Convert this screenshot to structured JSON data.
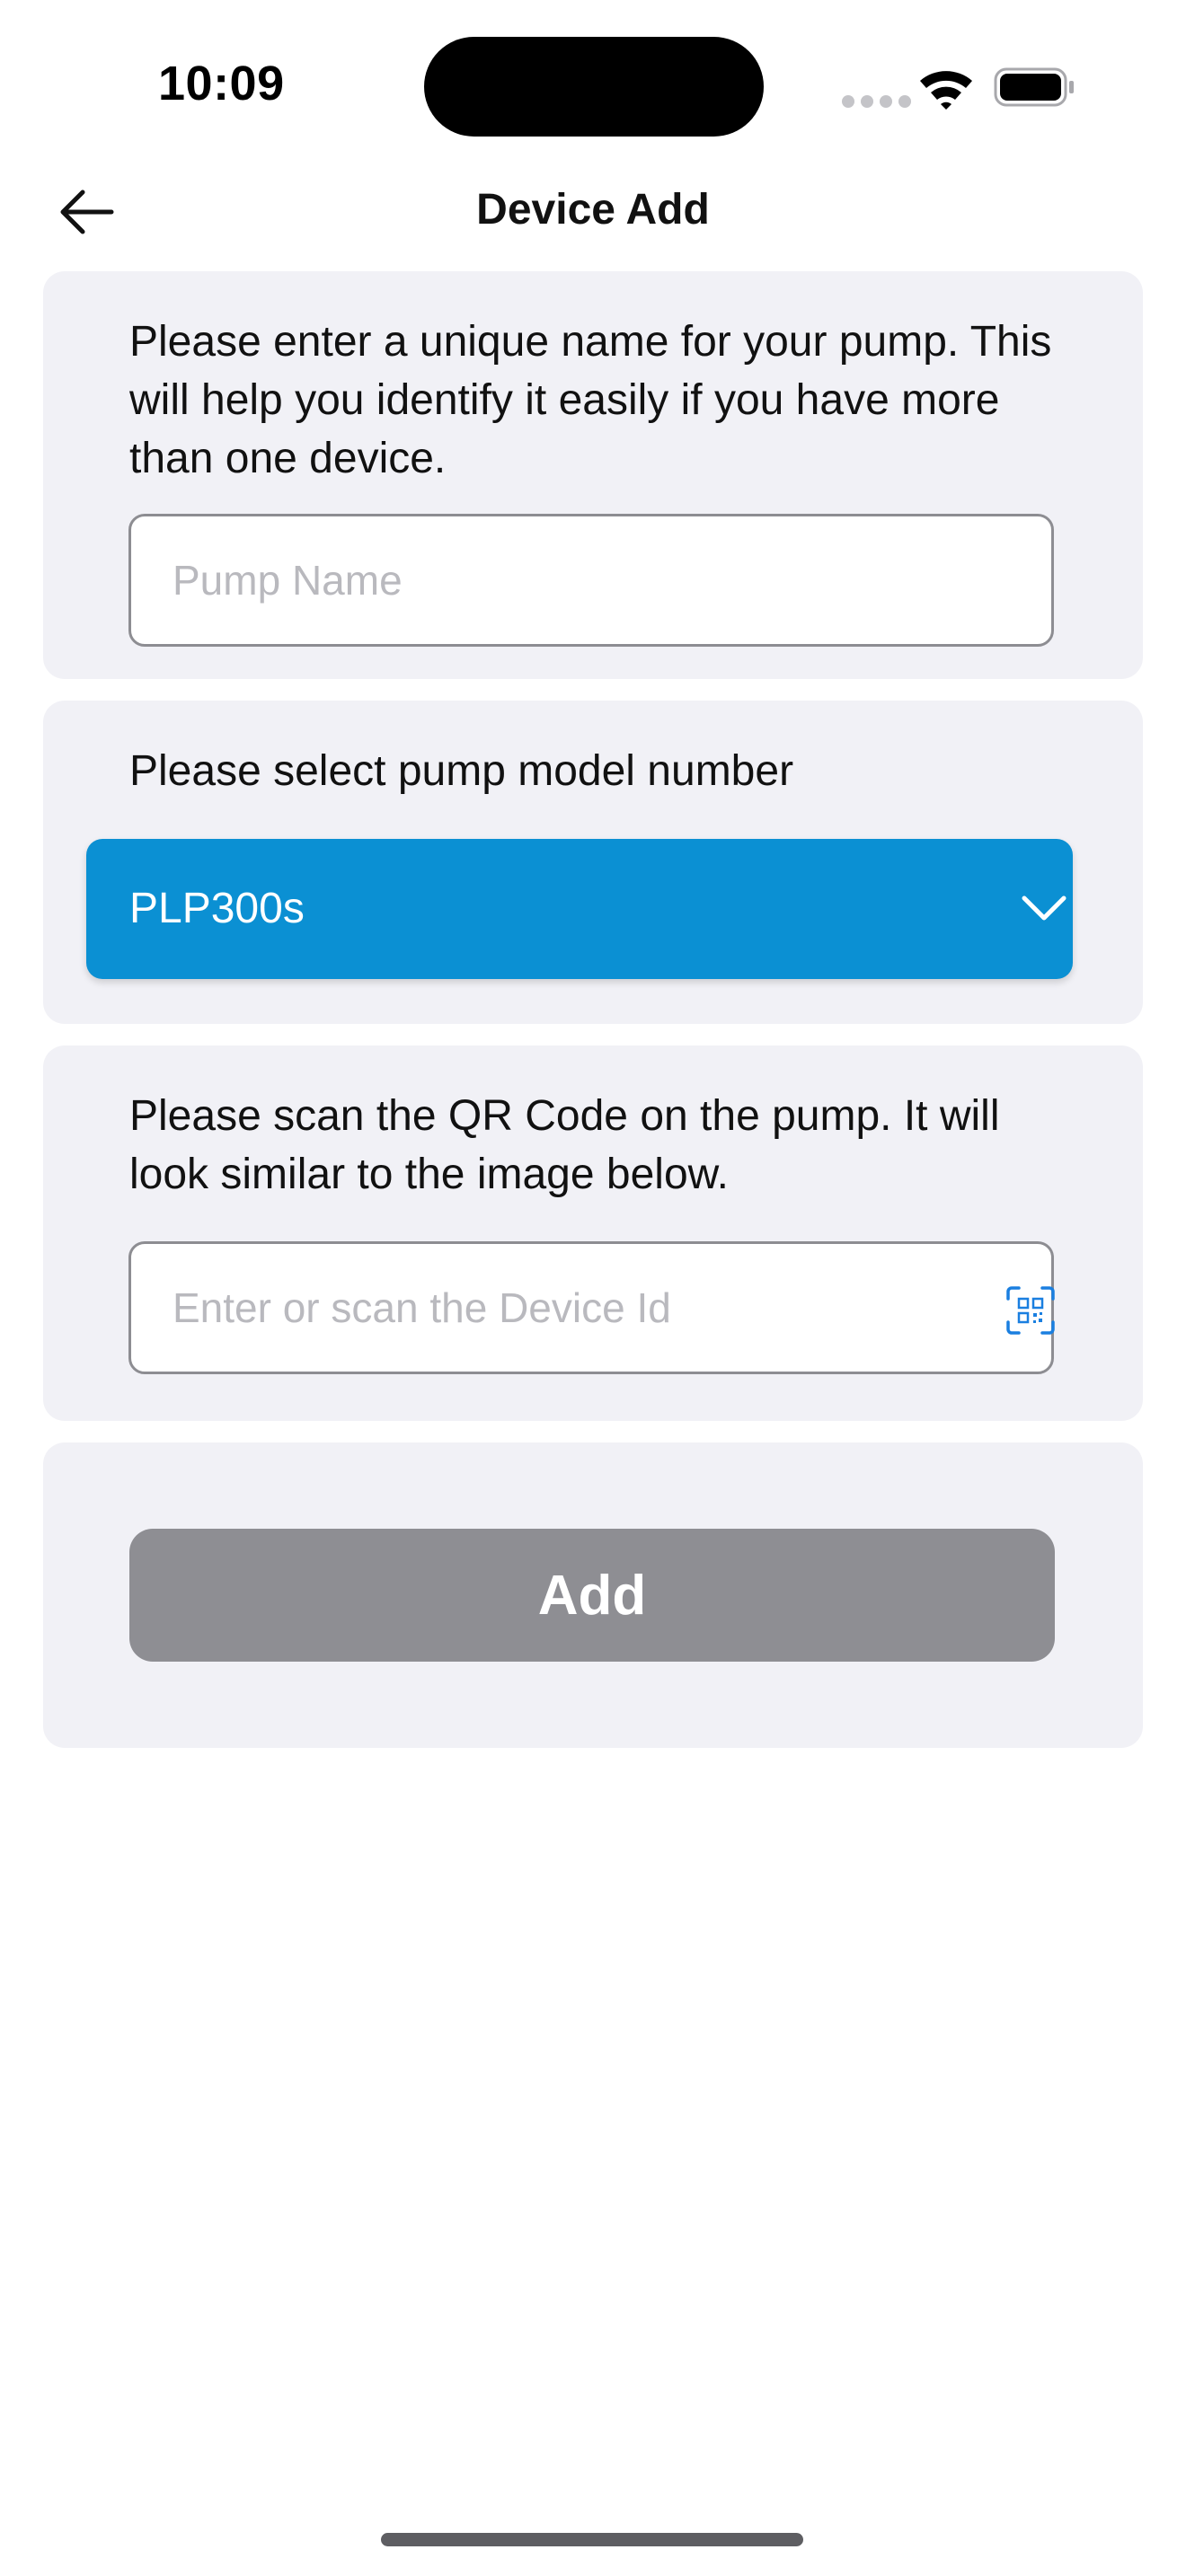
{
  "status_bar": {
    "time": "10:09",
    "icons": [
      "signal-dots-icon",
      "wifi-icon",
      "battery-icon"
    ]
  },
  "header": {
    "title": "Device Add",
    "back_icon": "arrow-left-icon"
  },
  "name_section": {
    "instruction": "Please enter a unique name for your pump. This will help you identify it easily if you have more than one device.",
    "input_value": "",
    "input_placeholder": "Pump Name"
  },
  "model_section": {
    "instruction": "Please select pump model number",
    "selected_value": "PLP300s",
    "dropdown_icon": "chevron-down-icon"
  },
  "qr_section": {
    "instruction": "Please scan the QR Code on the pump. It will look similar to the image below.",
    "input_value": "",
    "input_placeholder": "Enter or scan the Device Id",
    "scan_icon": "qr-scan-icon"
  },
  "actions": {
    "add_label": "Add"
  },
  "colors": {
    "accent": "#0b90d3",
    "card_background": "#f1f1f6",
    "disabled_button": "#8e8e93",
    "placeholder_text": "#b9b9be",
    "input_border": "#8d8d92"
  }
}
